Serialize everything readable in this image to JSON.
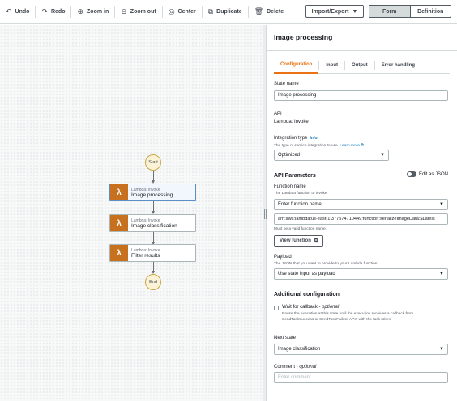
{
  "toolbar": {
    "undo": "Undo",
    "redo": "Redo",
    "zoom_in": "Zoom in",
    "zoom_out": "Zoom out",
    "center": "Center",
    "duplicate": "Duplicate",
    "delete": "Delete",
    "import_export": "Import/Export",
    "form": "Form",
    "definition": "Definition"
  },
  "workflow": {
    "start": "Start",
    "end": "End",
    "states": [
      {
        "type": "Lambda: Invoke",
        "name": "Image processing"
      },
      {
        "type": "Lambda: Invoke",
        "name": "Image classification"
      },
      {
        "type": "Lambda: Invoke",
        "name": "Filter results"
      }
    ]
  },
  "panel": {
    "title": "Image processing",
    "tabs": [
      "Configuration",
      "Input",
      "Output",
      "Error handling"
    ],
    "state_name_label": "State name",
    "state_name_value": "Image processing",
    "api_label": "API",
    "api_value": "Lambda: Invoke",
    "integration_label": "Integration type",
    "integration_info": "Info",
    "integration_desc": "The type of service integration to use.",
    "integration_learn": "Learn more",
    "integration_value": "Optimized",
    "api_params_heading": "API Parameters",
    "edit_json": "Edit as JSON",
    "function_name_label": "Function name",
    "function_name_desc": "The Lambda function to invoke",
    "function_name_select": "Enter function name",
    "function_arn": "arn:aws:lambda:us-east-1:377574710449:function:serializeImageData:$Latest",
    "function_hint": "Must be a valid function name.",
    "view_function": "View function",
    "payload_label": "Payload",
    "payload_desc": "The JSON that you want to provide to your Lambda function.",
    "payload_value": "Use state input as payload",
    "additional_heading": "Additional configuration",
    "wait_label": "Wait for callback -",
    "wait_optional": "optional",
    "wait_desc_1": "Pause the execution at this state until the execution receives a callback from",
    "wait_desc_2": "SendTaskSuccess or SendTaskFailure APIs with the task token.",
    "next_state_label": "Next state",
    "next_state_value": "Image classification",
    "comment_label": "Comment -",
    "comment_optional": "optional",
    "comment_placeholder": "Enter comment"
  },
  "colors": {
    "accent": "#ec7211",
    "lambda": "#c7701d",
    "link": "#0073bb"
  }
}
